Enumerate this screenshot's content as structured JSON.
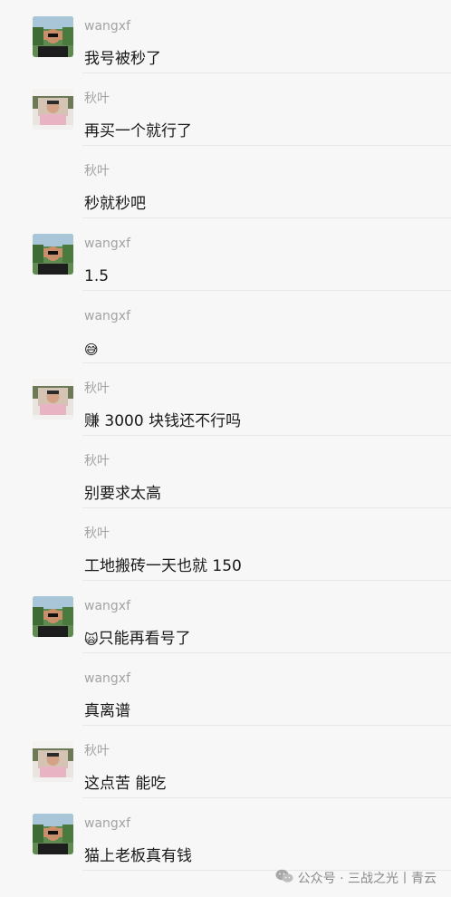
{
  "messages": [
    {
      "sender": "wangxf",
      "avatar": "avatar-wangxf",
      "text": "我号被秒了"
    },
    {
      "sender": "秋叶",
      "avatar": "avatar-qiuye",
      "text": "再买一个就行了"
    },
    {
      "sender": "秋叶",
      "avatar": null,
      "text": "秒就秒吧"
    },
    {
      "sender": "wangxf",
      "avatar": "avatar-wangxf",
      "text": "1.5"
    },
    {
      "sender": "wangxf",
      "avatar": null,
      "text": "",
      "emoji": "sweat-smile-emoji",
      "emoji_char": "😅"
    },
    {
      "sender": "秋叶",
      "avatar": "avatar-qiuye",
      "text": "赚 3000 块钱还不行吗"
    },
    {
      "sender": "秋叶",
      "avatar": null,
      "text": "别要求太高"
    },
    {
      "sender": "秋叶",
      "avatar": null,
      "text": "工地搬砖一天也就 150"
    },
    {
      "sender": "wangxf",
      "avatar": "avatar-wangxf",
      "text": "只能再看号了",
      "emoji": "cat-emoji",
      "emoji_char": "🙀"
    },
    {
      "sender": "wangxf",
      "avatar": null,
      "text": "真离谱"
    },
    {
      "sender": "秋叶",
      "avatar": "avatar-qiuye",
      "text": "这点苦 能吃"
    },
    {
      "sender": "wangxf",
      "avatar": "avatar-wangxf",
      "text": "猫上老板真有钱"
    }
  ],
  "watermark": {
    "icon": "wechat-icon",
    "text": "公众号 · 三战之光丨青云"
  },
  "colors": {
    "background": "#f7f7f7",
    "sender_text": "#a3a3a3",
    "message_text": "#191919",
    "divider": "#e7e7e7"
  }
}
